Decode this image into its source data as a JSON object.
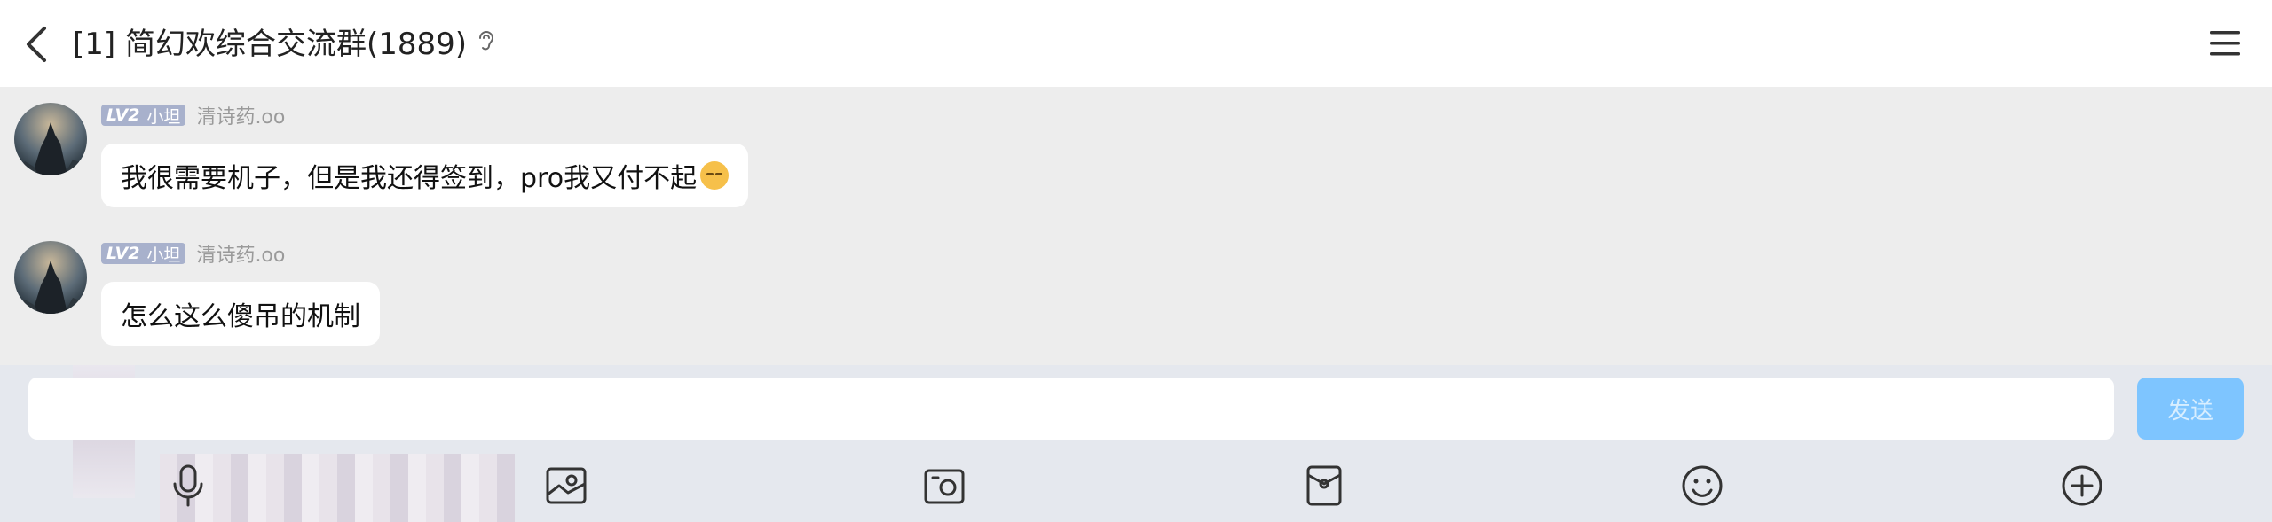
{
  "header": {
    "title": "[1] 简幻欢综合交流群(1889)"
  },
  "messages": [
    {
      "level": "LV2",
      "rank": "小坦",
      "nickname": "清诗药.oo",
      "text": "我很需要机子，但是我还得签到，pro我又付不起"
    },
    {
      "level": "LV2",
      "rank": "小坦",
      "nickname": "清诗药.oo",
      "text": "怎么这么傻吊的机制"
    }
  ],
  "composer": {
    "value": "",
    "placeholder": "",
    "send_label": "发送"
  },
  "icons": {
    "back": "chevron-left-icon",
    "ear": "ear-icon",
    "menu": "hamburger-menu-icon",
    "toolbar": [
      "microphone-icon",
      "image-icon",
      "camera-icon",
      "red-packet-icon",
      "emoji-icon",
      "plus-icon"
    ]
  },
  "colors": {
    "send_button": "#7ec5ff",
    "level_badge": "#a8b1cc",
    "chat_bg": "#ededed"
  }
}
